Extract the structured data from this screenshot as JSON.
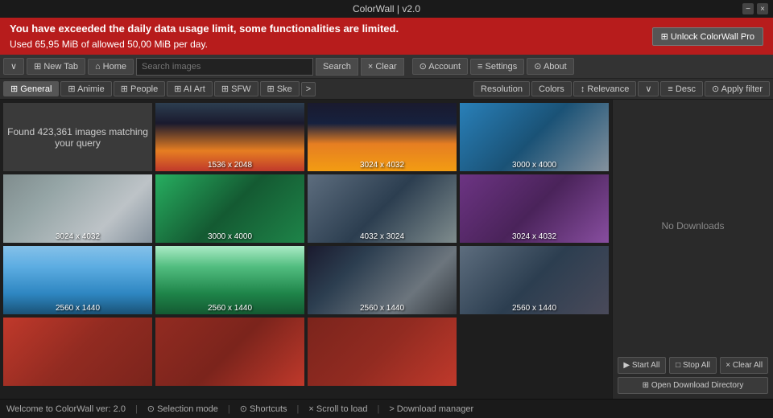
{
  "titleBar": {
    "title": "ColorWall | v2.0",
    "controls": {
      "minimize": "−",
      "close": "×"
    }
  },
  "warningBanner": {
    "line1": "You have exceeded the daily data usage limit, some functionalities are limited.",
    "line2": "Used 65,95 MiB of allowed 50,00 MiB per day.",
    "unlockBtn": "⊞ Unlock ColorWall Pro"
  },
  "toolbar": {
    "dropdown": "∨",
    "newTab": "⊞ New Tab",
    "home": "⌂ Home",
    "searchPlaceholder": "Search images",
    "searchBtn": "Search",
    "clearBtn": "× Clear",
    "account": "⊙ Account",
    "settings": "≡ Settings",
    "about": "⊙ About"
  },
  "filterBar": {
    "tabs": [
      {
        "label": "⊞ General",
        "active": true
      },
      {
        "label": "⊞ Animie"
      },
      {
        "label": "⊞ People"
      },
      {
        "label": "⊞ AI Art"
      },
      {
        "label": "⊞ SFW"
      },
      {
        "label": "⊞ Ske"
      }
    ],
    "more": ">",
    "endTabs": [
      {
        "label": "Resolution"
      },
      {
        "label": "Colors"
      },
      {
        "label": "↕ Relevance"
      },
      {
        "label": "∨"
      },
      {
        "label": "≡ Desc"
      },
      {
        "label": "⊙ Apply filter"
      }
    ]
  },
  "imageGrid": {
    "foundText": "Found 423,361 images\nmatching your query",
    "images": [
      {
        "size": "1536 x 2048",
        "class": "img-2"
      },
      {
        "size": "3024 x 4032",
        "class": "img-3"
      },
      {
        "size": "3000 x 4000",
        "class": "img-4"
      },
      {
        "size": "3024 x 4032",
        "class": "img-5"
      },
      {
        "size": "3000 x 4000",
        "class": "img-6"
      },
      {
        "size": "4032 x 3024",
        "class": "img-7"
      },
      {
        "size": "3024 x 4032",
        "class": "img-8"
      },
      {
        "size": "2560 x 1440",
        "class": "img-9"
      },
      {
        "size": "2560 x 1440",
        "class": "img-10"
      },
      {
        "size": "2560 x 1440",
        "class": "img-11"
      },
      {
        "size": "2560 x 1440",
        "class": "img-12"
      },
      {
        "size": "",
        "class": "img-13"
      },
      {
        "size": "",
        "class": "img-14"
      },
      {
        "size": "",
        "class": "img-15"
      }
    ]
  },
  "rightPanel": {
    "noDownloads": "No Downloads",
    "startAll": "▶ Start All",
    "stopAll": "□ Stop All",
    "clearAll": "× Clear All",
    "openDir": "⊞ Open Download Directory"
  },
  "statusBar": {
    "welcome": "Welcome to ColorWall ver: 2.0",
    "selection": "⊙ Selection mode",
    "shortcuts": "⊙ Shortcuts",
    "scrollToLoad": "× Scroll to load",
    "downloadManager": "> Download manager"
  }
}
